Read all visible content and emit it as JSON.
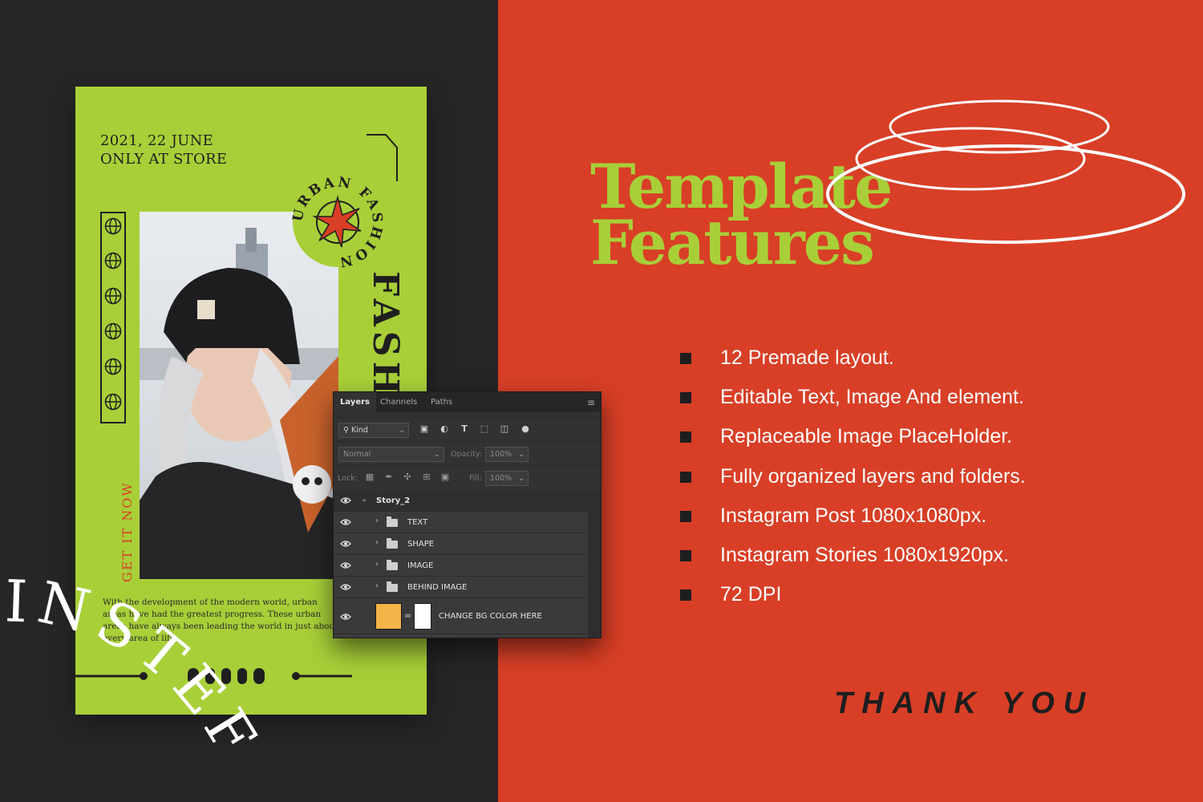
{
  "story": {
    "date_line1": "2021, 22 JUNE",
    "date_line2": "ONLY AT STORE",
    "badge_text": "URBAN FASHION",
    "side_text_red": "GET IT NOW",
    "side_text_big": "FASHION NOW",
    "body_text": "With the development of the modern world, urban areas have had the greatest progress. These urban areas have always been leading the world in just about every area of life.",
    "curved_text": "INSTEF",
    "colors": {
      "background": "#a8cf38",
      "accent": "#d83f26",
      "ink": "#1f1f1f"
    }
  },
  "heading": {
    "line1": "Template",
    "line2": "Features"
  },
  "features": [
    "12 Premade layout.",
    "Editable Text, Image And element.",
    "Replaceable Image PlaceHolder.",
    "Fully organized layers and folders.",
    "Instagram Post 1080x1080px.",
    "Instagram Stories 1080x1920px.",
    "72 DPI"
  ],
  "thank_you": "THANK YOU",
  "layers_panel": {
    "tabs": [
      "Layers",
      "Channels",
      "Paths"
    ],
    "active_tab": "Layers",
    "filter_label": "Kind",
    "blend_mode": "Normal",
    "opacity_label": "Opacity:",
    "opacity_value": "100%",
    "lock_label": "Lock:",
    "fill_label": "Fill:",
    "fill_value": "100%",
    "group": "Story_2",
    "layers": [
      "TEXT",
      "SHAPE",
      "IMAGE",
      "BEHIND IMAGE"
    ],
    "bg_layer": "CHANGE BG COLOR HERE",
    "bg_swatch_color": "#f4b548"
  },
  "colors": {
    "left_background": "#262626",
    "right_background": "#d83f26",
    "heading": "#a8cf38",
    "feature_text": "#ffffff",
    "bullet": "#1e1e1e"
  }
}
